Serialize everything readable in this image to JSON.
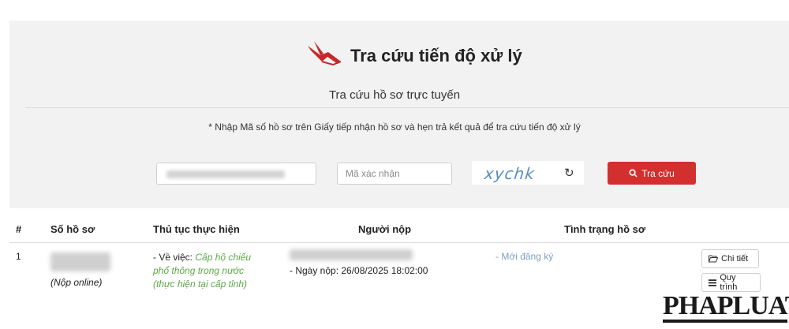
{
  "header": {
    "title": "Tra cứu tiến độ xử lý",
    "subtitle": "Tra cứu hồ sơ trực tuyến",
    "instruction": "* Nhập Mã số hồ sơ trên Giấy tiếp nhận hồ sơ và hẹn trả kết quả để tra cứu tiến độ xử lý"
  },
  "form": {
    "code_placeholder": "",
    "captcha_placeholder": "Mã xác nhận",
    "captcha_text": "xychk",
    "refresh_icon": "↻",
    "search_label": "Tra cứu"
  },
  "table": {
    "headers": [
      "#",
      "Số hồ sơ",
      "Thủ tục thực hiện",
      "Người nộp",
      "Tình trạng hồ sơ"
    ],
    "rows": [
      {
        "index": "1",
        "submit_method": "(Nộp online)",
        "procedure_prefix": "- Về việc: ",
        "procedure_line1": "Cấp hộ chiếu",
        "procedure_line2": "phổ thông trong nước",
        "procedure_line3": "(thực hiện tại cấp tỉnh)",
        "submit_date": "- Ngày nộp: 26/08/2025 18:02:00",
        "status": "- Mới đăng ký",
        "detail_label": "Chi tiết",
        "process_label": "Quy trình"
      }
    ]
  },
  "watermark": {
    "text": "PHAPLUAT"
  },
  "colors": {
    "accent": "#d32f2f",
    "status": "#7f9fc0",
    "procedure": "#5fa84a",
    "captcha": "#5b8ec2"
  },
  "icons": {
    "logo": "flying-bird-logo-icon",
    "search": "search-icon",
    "refresh": "refresh-icon",
    "folder": "folder-open-icon",
    "list": "list-icon"
  }
}
